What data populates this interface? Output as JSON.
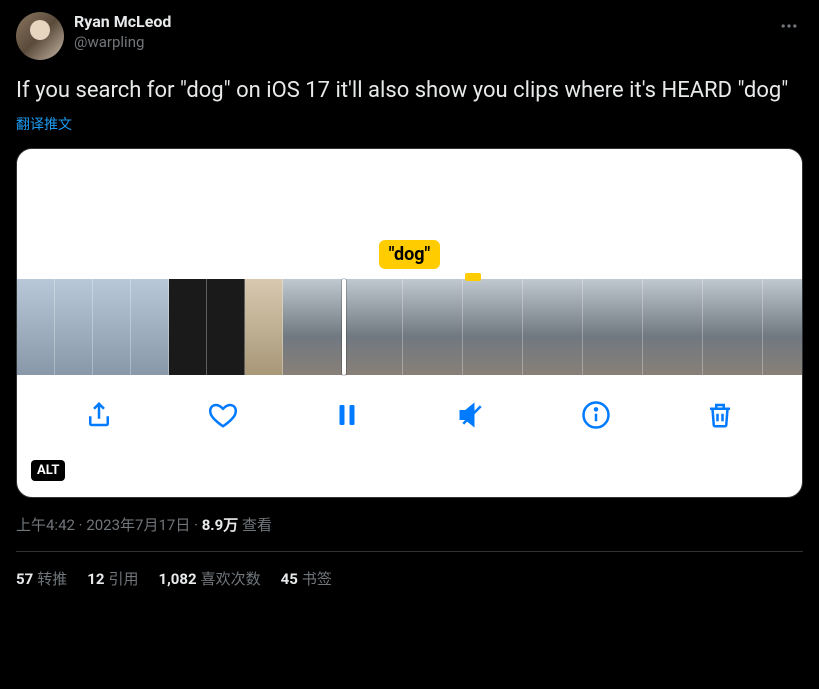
{
  "author": {
    "display_name": "Ryan McLeod",
    "handle": "@warpling"
  },
  "tweet_text": "If you search for \"dog\" on iOS 17 it'll also show you clips where it's HEARD \"dog\"",
  "translate_label": "翻译推文",
  "media": {
    "search_label": "\"dog\"",
    "alt_badge": "ALT"
  },
  "meta": {
    "time": "上午4:42",
    "date": "2023年7月17日",
    "views_number": "8.9万",
    "views_label": "查看",
    "separator": " · "
  },
  "stats": {
    "retweets_num": "57",
    "retweets_label": "转推",
    "quotes_num": "12",
    "quotes_label": "引用",
    "likes_num": "1,082",
    "likes_label": "喜欢次数",
    "bookmarks_num": "45",
    "bookmarks_label": "书签"
  }
}
